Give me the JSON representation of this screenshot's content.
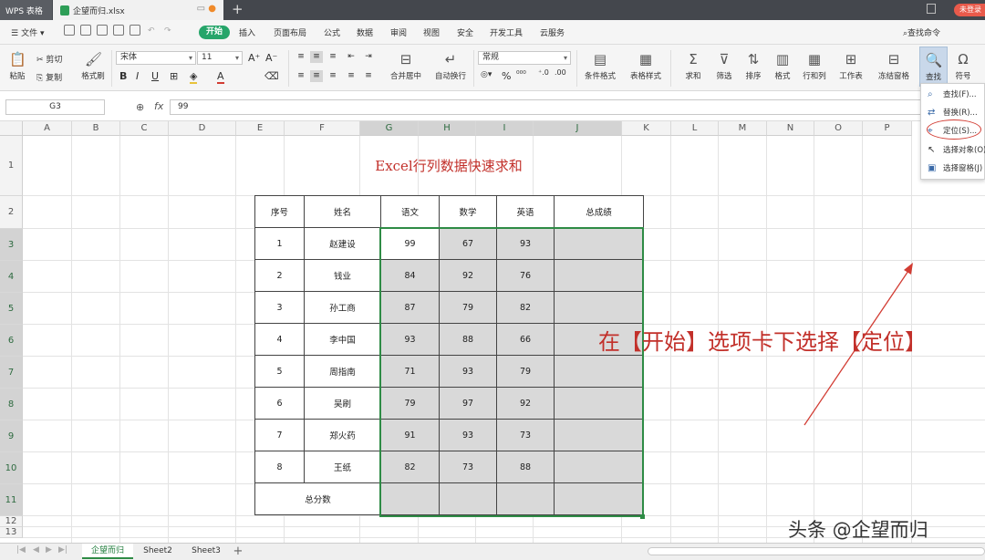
{
  "titlebar": {
    "app_tab": "WPS 表格",
    "file_tab": "企望而归.xlsx",
    "new_tab": "+",
    "login": "未登录"
  },
  "menubar": {
    "file": "文件",
    "items": [
      "开始",
      "插入",
      "页面布局",
      "公式",
      "数据",
      "审阅",
      "视图",
      "安全",
      "开发工具",
      "云服务"
    ],
    "search": "查找命令"
  },
  "ribbon": {
    "paste": "粘贴",
    "cut": "剪切",
    "copy": "复制",
    "format_painter": "格式刷",
    "font_name": "宋体",
    "font_size": "11",
    "merge_center": "合并居中",
    "wrap_text": "自动换行",
    "number_format": "常规",
    "conditional_format": "条件格式",
    "table_style": "表格样式",
    "sum": "求和",
    "filter": "筛选",
    "sort": "排序",
    "format": "格式",
    "row_col": "行和列",
    "worksheet": "工作表",
    "freeze": "冻结窗格",
    "find": "查找",
    "symbol": "符号"
  },
  "formula_bar": {
    "name_box": "G3",
    "fx": "fx",
    "value": "99"
  },
  "grid": {
    "columns": [
      "A",
      "B",
      "C",
      "D",
      "E",
      "F",
      "G",
      "H",
      "I",
      "J",
      "K",
      "L",
      "M",
      "N",
      "O",
      "P"
    ],
    "rows": [
      "1",
      "2",
      "3",
      "4",
      "5",
      "6",
      "7",
      "8",
      "9",
      "10",
      "11",
      "12",
      "13"
    ]
  },
  "sheet": {
    "title": "Excel行列数据快速求和",
    "headers": [
      "序号",
      "姓名",
      "语文",
      "数学",
      "英语",
      "总成绩"
    ],
    "rows": [
      [
        "1",
        "赵建设",
        "99",
        "67",
        "93",
        ""
      ],
      [
        "2",
        "钱业",
        "84",
        "92",
        "76",
        ""
      ],
      [
        "3",
        "孙工商",
        "87",
        "79",
        "82",
        ""
      ],
      [
        "4",
        "李中国",
        "93",
        "88",
        "66",
        ""
      ],
      [
        "5",
        "周指南",
        "71",
        "93",
        "79",
        ""
      ],
      [
        "6",
        "吴刷",
        "79",
        "97",
        "92",
        ""
      ],
      [
        "7",
        "郑火药",
        "91",
        "93",
        "73",
        ""
      ],
      [
        "8",
        "王纸",
        "82",
        "73",
        "88",
        ""
      ]
    ],
    "total_label": "总分数"
  },
  "find_menu": {
    "items": [
      "查找(F)...",
      "替换(R)...",
      "定位(S)...",
      "选择对象(O)",
      "选择窗格(J)"
    ]
  },
  "annotation": {
    "callout": "在【开始】选项卡下选择【定位】",
    "watermark": "头条 @企望而归"
  },
  "sheet_tabs": {
    "tabs": [
      "企望而归",
      "Sheet2",
      "Sheet3"
    ],
    "add": "+"
  },
  "colors": {
    "accent_green": "#26a56a",
    "selection_green": "#2e8b45",
    "annotation_red": "#c2302a"
  }
}
